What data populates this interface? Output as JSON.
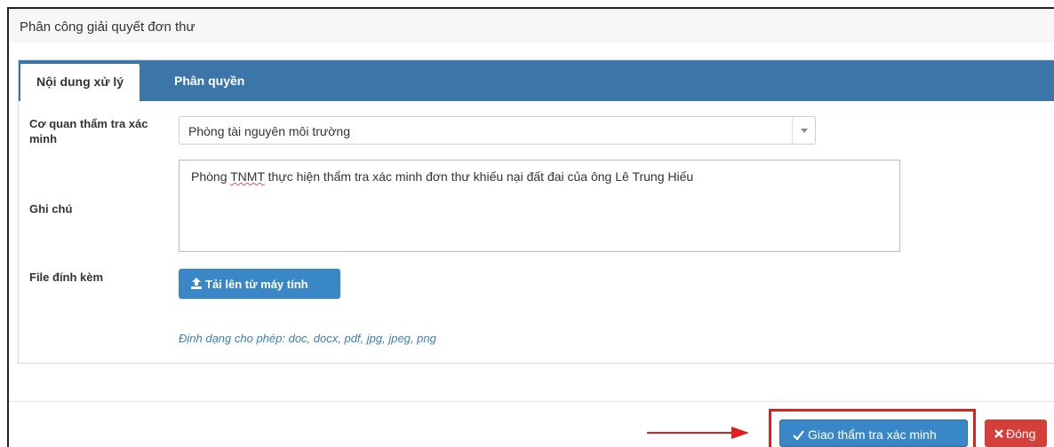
{
  "dialog": {
    "title": "Phân công giải quyết đơn thư"
  },
  "tabs": [
    {
      "label": "Nội dung xử lý",
      "active": true
    },
    {
      "label": "Phân quyền",
      "active": false
    }
  ],
  "form": {
    "agency_label_line1": "Cơ quan thẩm tra xác",
    "agency_label_line2": "minh",
    "agency_value": "Phòng tài nguyên môi trường",
    "note_label": "Ghi chú",
    "note_value_prefix": "Phòng ",
    "note_value_abbrev": "TNMT",
    "note_value_suffix": " thực hiện thẩm tra xác minh đơn thư khiếu nại đất đai của ông Lê Trung Hiếu",
    "attachment_label": "File đính kèm",
    "upload_button": "Tải lên từ máy tính",
    "allowed_formats": "Định dạng cho phép: doc, docx, pdf, jpg, jpeg, png"
  },
  "footer": {
    "submit_button": "Giao thẩm tra xác minh",
    "close_button": "Đóng"
  },
  "icons": {
    "upload": "upload-icon",
    "check": "check-icon",
    "close": "times-icon",
    "dropdown": "chevron-down-icon",
    "annotation": "arrow-right-icon"
  },
  "colors": {
    "tabbar": "#3c75a8",
    "primary": "#3a87c8",
    "danger": "#d43f3a",
    "highlight": "#e0201c",
    "hint": "#3a7fc1"
  }
}
